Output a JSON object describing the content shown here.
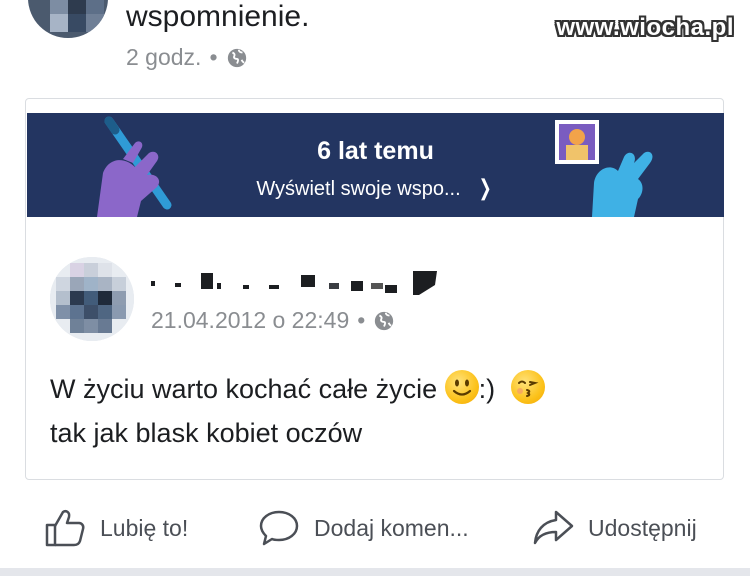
{
  "post": {
    "text_fragment": "wspomnienie.",
    "time": "2 godz.",
    "separator": "•"
  },
  "watermark": "www.wiocha.pl",
  "memory_banner": {
    "title": "6 lat temu",
    "link_label": "Wyświetl swoje wspo...",
    "bg_color": "#233561"
  },
  "original_post": {
    "date": "21.04.2012 o 22:49",
    "separator": "•",
    "line1": "W życiu warto kochać całe życie",
    "line1_suffix": ":)",
    "line2": "tak jak blask kobiet oczów"
  },
  "actions": {
    "like_label": "Lubię to!",
    "comment_label": "Dodaj komen...",
    "share_label": "Udostępnij"
  },
  "icons": [
    "globe-icon",
    "chevron-right-icon",
    "like-icon",
    "comment-icon",
    "share-icon",
    "smiley-emoji",
    "kiss-emoji"
  ]
}
